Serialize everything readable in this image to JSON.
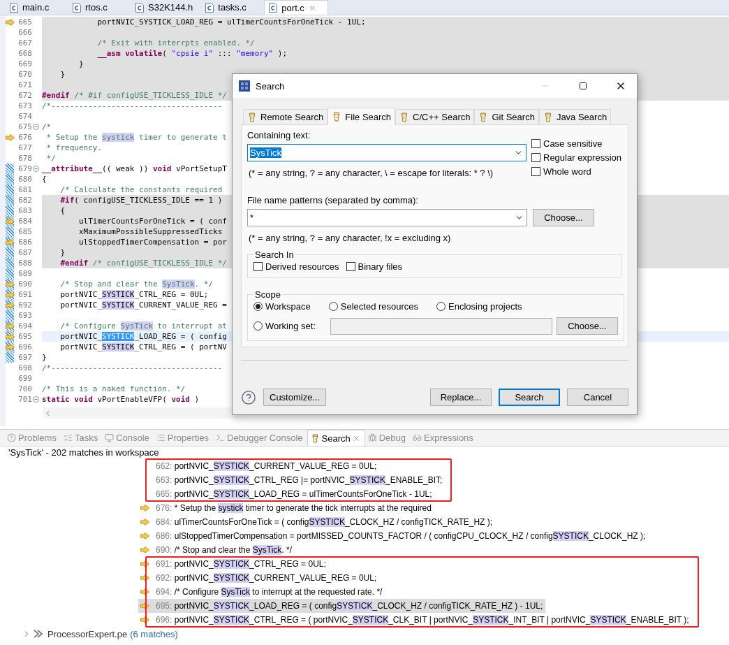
{
  "editor_tabs": [
    {
      "label": "main.c",
      "selected": false
    },
    {
      "label": "rtos.c",
      "selected": false
    },
    {
      "label": "S32K144.h",
      "selected": false
    },
    {
      "label": "tasks.c",
      "selected": false
    },
    {
      "label": "port.c",
      "selected": true
    }
  ],
  "editor": {
    "lines": [
      {
        "num": "665",
        "marker": true,
        "changed": false,
        "fold": false,
        "inactive": true,
        "current": false,
        "tokens": [
          {
            "kind": "plain",
            "text": "            portNVIC_SYSTICK_LOAD_REG = ulTimerCountsForOneTick - 1UL;"
          }
        ]
      },
      {
        "num": "666",
        "marker": false,
        "changed": false,
        "fold": false,
        "inactive": true,
        "current": false
      },
      {
        "num": "667",
        "marker": false,
        "changed": false,
        "fold": false,
        "inactive": true,
        "current": false,
        "tokens": [
          {
            "kind": "comment",
            "text": "            /* Exit with interrpts enabled. */"
          }
        ]
      },
      {
        "num": "668",
        "marker": false,
        "changed": false,
        "fold": false,
        "inactive": true,
        "current": false,
        "tokens": [
          {
            "kind": "keyword",
            "text": "            __asm volatile"
          },
          {
            "kind": "plain",
            "text": "( "
          },
          {
            "kind": "string",
            "text": "\"cpsie i\""
          },
          {
            "kind": "plain",
            "text": " ::: "
          },
          {
            "kind": "string",
            "text": "\"memory\""
          },
          {
            "kind": "plain",
            "text": " );"
          }
        ]
      },
      {
        "num": "669",
        "marker": false,
        "changed": false,
        "fold": false,
        "inactive": true,
        "current": false,
        "tokens": [
          {
            "kind": "plain",
            "text": "        }"
          }
        ]
      },
      {
        "num": "670",
        "marker": false,
        "changed": false,
        "fold": false,
        "inactive": true,
        "current": false,
        "tokens": [
          {
            "kind": "plain",
            "text": "    }"
          }
        ]
      },
      {
        "num": "671",
        "marker": false,
        "changed": false,
        "fold": false,
        "inactive": true,
        "current": false
      },
      {
        "num": "672",
        "marker": false,
        "changed": false,
        "fold": false,
        "inactive": true,
        "current": false,
        "tokens": [
          {
            "kind": "keyword",
            "text": "#endif"
          },
          {
            "kind": "comment",
            "text": " /* #if configUSE_TICKLESS_IDLE */"
          }
        ]
      },
      {
        "num": "673",
        "marker": false,
        "changed": false,
        "fold": false,
        "inactive": false,
        "current": false,
        "tokens": [
          {
            "kind": "comment",
            "text": "/*-------------------------------------"
          }
        ]
      },
      {
        "num": "674",
        "marker": false,
        "changed": false,
        "fold": false,
        "inactive": false,
        "current": false
      },
      {
        "num": "675",
        "marker": false,
        "changed": false,
        "fold": true,
        "inactive": false,
        "current": false,
        "tokens": [
          {
            "kind": "comment",
            "text": "/*"
          }
        ]
      },
      {
        "num": "676",
        "marker": true,
        "changed": false,
        "fold": false,
        "inactive": false,
        "current": false,
        "tokens": [
          {
            "kind": "comment",
            "text": " * Setup the "
          },
          {
            "kind": "comment_match",
            "text": "systick"
          },
          {
            "kind": "comment",
            "text": " timer to generate t"
          }
        ]
      },
      {
        "num": "677",
        "marker": false,
        "changed": false,
        "fold": false,
        "inactive": false,
        "current": false,
        "tokens": [
          {
            "kind": "comment",
            "text": " * frequency."
          }
        ]
      },
      {
        "num": "678",
        "marker": false,
        "changed": false,
        "fold": false,
        "inactive": false,
        "current": false,
        "tokens": [
          {
            "kind": "comment",
            "text": " */"
          }
        ]
      },
      {
        "num": "679",
        "marker": false,
        "changed": true,
        "fold": true,
        "inactive": false,
        "current": false,
        "tokens": [
          {
            "kind": "keyword",
            "text": "__attribute__"
          },
          {
            "kind": "plain",
            "text": "(( weak )) "
          },
          {
            "kind": "keyword",
            "text": "void"
          },
          {
            "kind": "plain",
            "text": " vPortSetupT"
          }
        ]
      },
      {
        "num": "680",
        "marker": false,
        "changed": true,
        "fold": false,
        "inactive": false,
        "current": false,
        "tokens": [
          {
            "kind": "plain",
            "text": "{"
          }
        ]
      },
      {
        "num": "681",
        "marker": false,
        "changed": true,
        "fold": false,
        "inactive": false,
        "current": false,
        "tokens": [
          {
            "kind": "comment",
            "text": "    /* Calculate the constants required"
          }
        ]
      },
      {
        "num": "682",
        "marker": false,
        "changed": true,
        "fold": false,
        "inactive": true,
        "current": false,
        "tokens": [
          {
            "kind": "keyword",
            "text": "    #if"
          },
          {
            "kind": "plain",
            "text": "( configUSE_TICKLESS_IDLE == 1 )"
          }
        ]
      },
      {
        "num": "683",
        "marker": false,
        "changed": true,
        "fold": false,
        "inactive": true,
        "current": false,
        "tokens": [
          {
            "kind": "plain",
            "text": "    {"
          }
        ]
      },
      {
        "num": "684",
        "marker": true,
        "changed": true,
        "fold": false,
        "inactive": true,
        "current": false,
        "tokens": [
          {
            "kind": "plain",
            "text": "        ulTimerCountsForOneTick = ( conf"
          }
        ]
      },
      {
        "num": "685",
        "marker": false,
        "changed": true,
        "fold": false,
        "inactive": true,
        "current": false,
        "tokens": [
          {
            "kind": "plain",
            "text": "        xMaximumPossibleSuppressedTicks"
          }
        ]
      },
      {
        "num": "686",
        "marker": true,
        "changed": true,
        "fold": false,
        "inactive": true,
        "current": false,
        "tokens": [
          {
            "kind": "plain",
            "text": "        ulStoppedTimerCompensation = por"
          }
        ]
      },
      {
        "num": "687",
        "marker": false,
        "changed": true,
        "fold": false,
        "inactive": true,
        "current": false,
        "tokens": [
          {
            "kind": "plain",
            "text": "    }"
          }
        ]
      },
      {
        "num": "688",
        "marker": false,
        "changed": true,
        "fold": false,
        "inactive": true,
        "current": false,
        "tokens": [
          {
            "kind": "keyword",
            "text": "    #endif"
          },
          {
            "kind": "comment",
            "text": " /* configUSE_TICKLESS_IDLE */"
          }
        ]
      },
      {
        "num": "689",
        "marker": false,
        "changed": true,
        "fold": false,
        "inactive": false,
        "current": false
      },
      {
        "num": "690",
        "marker": true,
        "changed": true,
        "fold": false,
        "inactive": false,
        "current": false,
        "tokens": [
          {
            "kind": "comment",
            "text": "    /* Stop and clear the "
          },
          {
            "kind": "comment_match",
            "text": "SysTick"
          },
          {
            "kind": "comment",
            "text": ". */"
          }
        ]
      },
      {
        "num": "691",
        "marker": true,
        "changed": true,
        "fold": false,
        "inactive": false,
        "current": false,
        "tokens": [
          {
            "kind": "plain",
            "text": "    portNVIC_"
          },
          {
            "kind": "match",
            "text": "SYSTICK"
          },
          {
            "kind": "plain",
            "text": "_CTRL_REG = 0UL;"
          }
        ]
      },
      {
        "num": "692",
        "marker": true,
        "changed": true,
        "fold": false,
        "inactive": false,
        "current": false,
        "tokens": [
          {
            "kind": "plain",
            "text": "    portNVIC_"
          },
          {
            "kind": "match",
            "text": "SYSTICK"
          },
          {
            "kind": "plain",
            "text": "_CURRENT_VALUE_REG ="
          }
        ]
      },
      {
        "num": "693",
        "marker": false,
        "changed": true,
        "fold": false,
        "inactive": false,
        "current": false
      },
      {
        "num": "694",
        "marker": true,
        "changed": true,
        "fold": false,
        "inactive": false,
        "current": false,
        "tokens": [
          {
            "kind": "comment",
            "text": "    /* Configure "
          },
          {
            "kind": "comment_match",
            "text": "SysTick"
          },
          {
            "kind": "comment",
            "text": " to interrupt at"
          }
        ]
      },
      {
        "num": "695",
        "marker": true,
        "changed": true,
        "fold": false,
        "inactive": false,
        "current": true,
        "tokens": [
          {
            "kind": "plain",
            "text": "    portNVIC_"
          },
          {
            "kind": "current_match",
            "text": "SYSTICK"
          },
          {
            "kind": "plain",
            "text": "_LOAD_REG = ( config"
          }
        ]
      },
      {
        "num": "696",
        "marker": true,
        "changed": true,
        "fold": false,
        "inactive": false,
        "current": false,
        "tokens": [
          {
            "kind": "plain",
            "text": "    portNVIC_"
          },
          {
            "kind": "match",
            "text": "SYSTICK"
          },
          {
            "kind": "plain",
            "text": "_CTRL_REG = ( portNV"
          }
        ]
      },
      {
        "num": "697",
        "marker": false,
        "changed": true,
        "fold": false,
        "inactive": false,
        "current": false,
        "tokens": [
          {
            "kind": "plain",
            "text": "}"
          }
        ]
      },
      {
        "num": "698",
        "marker": false,
        "changed": false,
        "fold": false,
        "inactive": false,
        "current": false,
        "tokens": [
          {
            "kind": "comment",
            "text": "/*-------------------------------------"
          }
        ]
      },
      {
        "num": "699",
        "marker": false,
        "changed": false,
        "fold": false,
        "inactive": false,
        "current": false
      },
      {
        "num": "700",
        "marker": false,
        "changed": false,
        "fold": false,
        "inactive": false,
        "current": false,
        "tokens": [
          {
            "kind": "comment",
            "text": "/* This is a naked function. */"
          }
        ]
      },
      {
        "num": "701",
        "marker": false,
        "changed": false,
        "fold": true,
        "inactive": false,
        "current": false,
        "tokens": [
          {
            "kind": "keyword",
            "text": "static void"
          },
          {
            "kind": "plain",
            "text": " vPortEnableVFP( "
          },
          {
            "kind": "keyword",
            "text": "void"
          },
          {
            "kind": "plain",
            "text": " )"
          }
        ]
      }
    ]
  },
  "dialog": {
    "title": "Search",
    "tabs": [
      {
        "label": "Remote Search",
        "selected": false
      },
      {
        "label": "File Search",
        "selected": true
      },
      {
        "label": "C/C++ Search",
        "selected": false
      },
      {
        "label": "Git Search",
        "selected": false
      },
      {
        "label": "Java Search",
        "selected": false
      }
    ],
    "containing_text": {
      "label": "Containing text:",
      "value": "SysTick",
      "hint": "(* = any string, ? = any character, \\ = escape for literals: * ? \\)"
    },
    "options": [
      {
        "label": "Case sensitive",
        "checked": false
      },
      {
        "label": "Regular expression",
        "checked": false
      },
      {
        "label": "Whole word",
        "checked": false
      }
    ],
    "file_patterns": {
      "label": "File name patterns (separated by comma):",
      "value": "*",
      "button": "Choose...",
      "hint": "(* = any string, ? = any character, !x = excluding x)"
    },
    "search_in": {
      "title": "Search In",
      "options": [
        {
          "label": "Derived resources",
          "checked": false
        },
        {
          "label": "Binary files",
          "checked": false
        }
      ]
    },
    "scope": {
      "title": "Scope",
      "options": [
        {
          "label": "Workspace",
          "selected": true
        },
        {
          "label": "Selected resources",
          "selected": false
        },
        {
          "label": "Enclosing projects",
          "selected": false
        }
      ],
      "working_set": {
        "label": "Working set:",
        "selected": false,
        "disabled": true,
        "button": "Choose..."
      }
    },
    "left_button": "Customize...",
    "buttons": [
      {
        "label": "Replace...",
        "default": false
      },
      {
        "label": "Search",
        "default": true
      },
      {
        "label": "Cancel",
        "default": false
      }
    ]
  },
  "views": {
    "tabs": [
      {
        "label": "Problems",
        "selected": false
      },
      {
        "label": "Tasks",
        "selected": false
      },
      {
        "label": "Console",
        "selected": false
      },
      {
        "label": "Properties",
        "selected": false
      },
      {
        "label": "Debugger Console",
        "selected": false
      },
      {
        "label": "Search",
        "selected": true
      },
      {
        "label": "Debug",
        "selected": false
      },
      {
        "label": "Expressions",
        "selected": false
      }
    ],
    "summary": "'SysTick' - 202 matches in workspace",
    "groups": [
      {
        "boxed": true,
        "rows": [
          {
            "line": "662:",
            "marker": false,
            "selected": false,
            "tokens": [
              {
                "kind": "plain",
                "text": "portNVIC_"
              },
              {
                "kind": "match",
                "text": "SYSTICK"
              },
              {
                "kind": "plain",
                "text": "_CURRENT_VALUE_REG = 0UL;"
              }
            ]
          },
          {
            "line": "663:",
            "marker": false,
            "selected": false,
            "tokens": [
              {
                "kind": "plain",
                "text": "portNVIC_"
              },
              {
                "kind": "match",
                "text": "SYSTICK"
              },
              {
                "kind": "plain",
                "text": "_CTRL_REG |= portNVIC_"
              },
              {
                "kind": "match",
                "text": "SYSTICK"
              },
              {
                "kind": "plain",
                "text": "_ENABLE_BIT;"
              }
            ]
          },
          {
            "line": "665:",
            "marker": false,
            "selected": false,
            "tokens": [
              {
                "kind": "plain",
                "text": "portNVIC_"
              },
              {
                "kind": "match",
                "text": "SYSTICK"
              },
              {
                "kind": "plain",
                "text": "_LOAD_REG = ulTimerCountsForOneTick - 1UL;"
              }
            ]
          }
        ]
      },
      {
        "boxed": false,
        "rows": [
          {
            "line": "676:",
            "marker": true,
            "selected": false,
            "tokens": [
              {
                "kind": "plain",
                "text": "* Setup the "
              },
              {
                "kind": "match",
                "text": "systick"
              },
              {
                "kind": "plain",
                "text": " timer to generate the tick interrupts at the required"
              }
            ]
          },
          {
            "line": "684:",
            "marker": true,
            "selected": false,
            "tokens": [
              {
                "kind": "plain",
                "text": "ulTimerCountsForOneTick = ( config"
              },
              {
                "kind": "match",
                "text": "SYSTICK"
              },
              {
                "kind": "plain",
                "text": "_CLOCK_HZ / configTICK_RATE_HZ );"
              }
            ]
          },
          {
            "line": "686:",
            "marker": true,
            "selected": false,
            "tokens": [
              {
                "kind": "plain",
                "text": "ulStoppedTimerCompensation = portMISSED_COUNTS_FACTOR / ( configCPU_CLOCK_HZ / config"
              },
              {
                "kind": "match",
                "text": "SYSTICK"
              },
              {
                "kind": "plain",
                "text": "_CLOCK_HZ );"
              }
            ]
          },
          {
            "line": "690:",
            "marker": true,
            "selected": false,
            "tokens": [
              {
                "kind": "plain",
                "text": "/* Stop and clear the "
              },
              {
                "kind": "match",
                "text": "SysTick"
              },
              {
                "kind": "plain",
                "text": ". */"
              }
            ]
          }
        ]
      },
      {
        "boxed": true,
        "rows": [
          {
            "line": "691:",
            "marker": true,
            "selected": false,
            "tokens": [
              {
                "kind": "plain",
                "text": "portNVIC_"
              },
              {
                "kind": "match",
                "text": "SYSTICK"
              },
              {
                "kind": "plain",
                "text": "_CTRL_REG = 0UL;"
              }
            ]
          },
          {
            "line": "692:",
            "marker": true,
            "selected": false,
            "tokens": [
              {
                "kind": "plain",
                "text": "portNVIC_"
              },
              {
                "kind": "match",
                "text": "SYSTICK"
              },
              {
                "kind": "plain",
                "text": "_CURRENT_VALUE_REG = 0UL;"
              }
            ]
          },
          {
            "line": "694:",
            "marker": true,
            "selected": false,
            "tokens": [
              {
                "kind": "plain",
                "text": "/* Configure "
              },
              {
                "kind": "match",
                "text": "SysTick"
              },
              {
                "kind": "plain",
                "text": " to interrupt at the requested rate. */"
              }
            ]
          },
          {
            "line": "695:",
            "marker": true,
            "selected": true,
            "tokens": [
              {
                "kind": "plain",
                "text": "portNVIC_"
              },
              {
                "kind": "match",
                "text": "SYSTICK"
              },
              {
                "kind": "plain",
                "text": "_LOAD_REG = ( config"
              },
              {
                "kind": "match",
                "text": "SYSTICK"
              },
              {
                "kind": "plain",
                "text": "_CLOCK_HZ / configTICK_RATE_HZ ) - 1UL;"
              }
            ]
          },
          {
            "line": "696:",
            "marker": true,
            "selected": false,
            "tokens": [
              {
                "kind": "plain",
                "text": "portNVIC_"
              },
              {
                "kind": "match",
                "text": "SYSTICK"
              },
              {
                "kind": "plain",
                "text": "_CTRL_REG = ( portNVIC_"
              },
              {
                "kind": "match",
                "text": "SYSTICK"
              },
              {
                "kind": "plain",
                "text": "_CLK_BIT | portNVIC_"
              },
              {
                "kind": "match",
                "text": "SYSTICK"
              },
              {
                "kind": "plain",
                "text": "_INT_BIT | portNVIC_"
              },
              {
                "kind": "match",
                "text": "SYSTICK"
              },
              {
                "kind": "plain",
                "text": "_ENABLE_BIT );"
              }
            ]
          }
        ]
      }
    ],
    "tree_item": {
      "name": "ProcessorExpert.pe",
      "count": "(6 matches)",
      "expanded": false
    }
  }
}
